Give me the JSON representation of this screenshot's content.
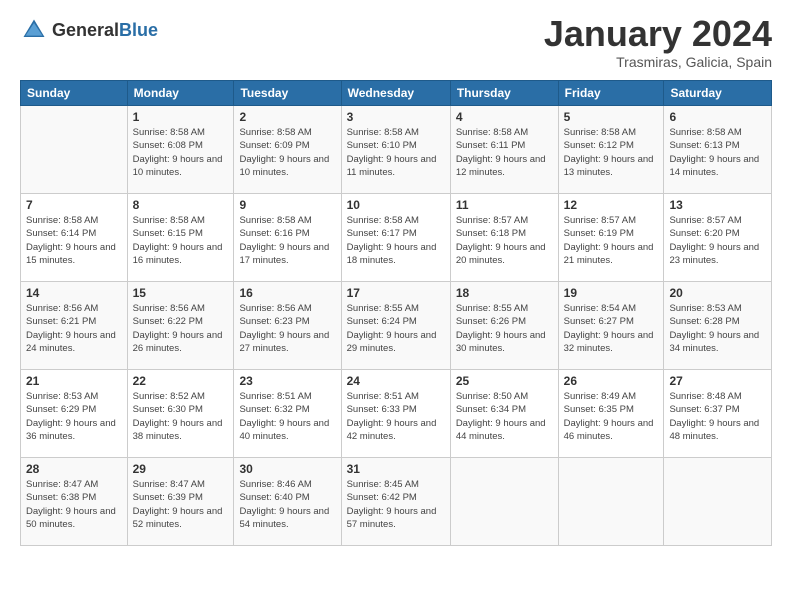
{
  "header": {
    "logo_general": "General",
    "logo_blue": "Blue",
    "month_title": "January 2024",
    "location": "Trasmiras, Galicia, Spain"
  },
  "columns": [
    "Sunday",
    "Monday",
    "Tuesday",
    "Wednesday",
    "Thursday",
    "Friday",
    "Saturday"
  ],
  "weeks": [
    [
      {
        "day": "",
        "sunrise": "",
        "sunset": "",
        "daylight": ""
      },
      {
        "day": "1",
        "sunrise": "8:58 AM",
        "sunset": "6:08 PM",
        "daylight": "9 hours and 10 minutes."
      },
      {
        "day": "2",
        "sunrise": "8:58 AM",
        "sunset": "6:09 PM",
        "daylight": "9 hours and 10 minutes."
      },
      {
        "day": "3",
        "sunrise": "8:58 AM",
        "sunset": "6:10 PM",
        "daylight": "9 hours and 11 minutes."
      },
      {
        "day": "4",
        "sunrise": "8:58 AM",
        "sunset": "6:11 PM",
        "daylight": "9 hours and 12 minutes."
      },
      {
        "day": "5",
        "sunrise": "8:58 AM",
        "sunset": "6:12 PM",
        "daylight": "9 hours and 13 minutes."
      },
      {
        "day": "6",
        "sunrise": "8:58 AM",
        "sunset": "6:13 PM",
        "daylight": "9 hours and 14 minutes."
      }
    ],
    [
      {
        "day": "7",
        "sunrise": "8:58 AM",
        "sunset": "6:14 PM",
        "daylight": "9 hours and 15 minutes."
      },
      {
        "day": "8",
        "sunrise": "8:58 AM",
        "sunset": "6:15 PM",
        "daylight": "9 hours and 16 minutes."
      },
      {
        "day": "9",
        "sunrise": "8:58 AM",
        "sunset": "6:16 PM",
        "daylight": "9 hours and 17 minutes."
      },
      {
        "day": "10",
        "sunrise": "8:58 AM",
        "sunset": "6:17 PM",
        "daylight": "9 hours and 18 minutes."
      },
      {
        "day": "11",
        "sunrise": "8:57 AM",
        "sunset": "6:18 PM",
        "daylight": "9 hours and 20 minutes."
      },
      {
        "day": "12",
        "sunrise": "8:57 AM",
        "sunset": "6:19 PM",
        "daylight": "9 hours and 21 minutes."
      },
      {
        "day": "13",
        "sunrise": "8:57 AM",
        "sunset": "6:20 PM",
        "daylight": "9 hours and 23 minutes."
      }
    ],
    [
      {
        "day": "14",
        "sunrise": "8:56 AM",
        "sunset": "6:21 PM",
        "daylight": "9 hours and 24 minutes."
      },
      {
        "day": "15",
        "sunrise": "8:56 AM",
        "sunset": "6:22 PM",
        "daylight": "9 hours and 26 minutes."
      },
      {
        "day": "16",
        "sunrise": "8:56 AM",
        "sunset": "6:23 PM",
        "daylight": "9 hours and 27 minutes."
      },
      {
        "day": "17",
        "sunrise": "8:55 AM",
        "sunset": "6:24 PM",
        "daylight": "9 hours and 29 minutes."
      },
      {
        "day": "18",
        "sunrise": "8:55 AM",
        "sunset": "6:26 PM",
        "daylight": "9 hours and 30 minutes."
      },
      {
        "day": "19",
        "sunrise": "8:54 AM",
        "sunset": "6:27 PM",
        "daylight": "9 hours and 32 minutes."
      },
      {
        "day": "20",
        "sunrise": "8:53 AM",
        "sunset": "6:28 PM",
        "daylight": "9 hours and 34 minutes."
      }
    ],
    [
      {
        "day": "21",
        "sunrise": "8:53 AM",
        "sunset": "6:29 PM",
        "daylight": "9 hours and 36 minutes."
      },
      {
        "day": "22",
        "sunrise": "8:52 AM",
        "sunset": "6:30 PM",
        "daylight": "9 hours and 38 minutes."
      },
      {
        "day": "23",
        "sunrise": "8:51 AM",
        "sunset": "6:32 PM",
        "daylight": "9 hours and 40 minutes."
      },
      {
        "day": "24",
        "sunrise": "8:51 AM",
        "sunset": "6:33 PM",
        "daylight": "9 hours and 42 minutes."
      },
      {
        "day": "25",
        "sunrise": "8:50 AM",
        "sunset": "6:34 PM",
        "daylight": "9 hours and 44 minutes."
      },
      {
        "day": "26",
        "sunrise": "8:49 AM",
        "sunset": "6:35 PM",
        "daylight": "9 hours and 46 minutes."
      },
      {
        "day": "27",
        "sunrise": "8:48 AM",
        "sunset": "6:37 PM",
        "daylight": "9 hours and 48 minutes."
      }
    ],
    [
      {
        "day": "28",
        "sunrise": "8:47 AM",
        "sunset": "6:38 PM",
        "daylight": "9 hours and 50 minutes."
      },
      {
        "day": "29",
        "sunrise": "8:47 AM",
        "sunset": "6:39 PM",
        "daylight": "9 hours and 52 minutes."
      },
      {
        "day": "30",
        "sunrise": "8:46 AM",
        "sunset": "6:40 PM",
        "daylight": "9 hours and 54 minutes."
      },
      {
        "day": "31",
        "sunrise": "8:45 AM",
        "sunset": "6:42 PM",
        "daylight": "9 hours and 57 minutes."
      },
      {
        "day": "",
        "sunrise": "",
        "sunset": "",
        "daylight": ""
      },
      {
        "day": "",
        "sunrise": "",
        "sunset": "",
        "daylight": ""
      },
      {
        "day": "",
        "sunrise": "",
        "sunset": "",
        "daylight": ""
      }
    ]
  ]
}
